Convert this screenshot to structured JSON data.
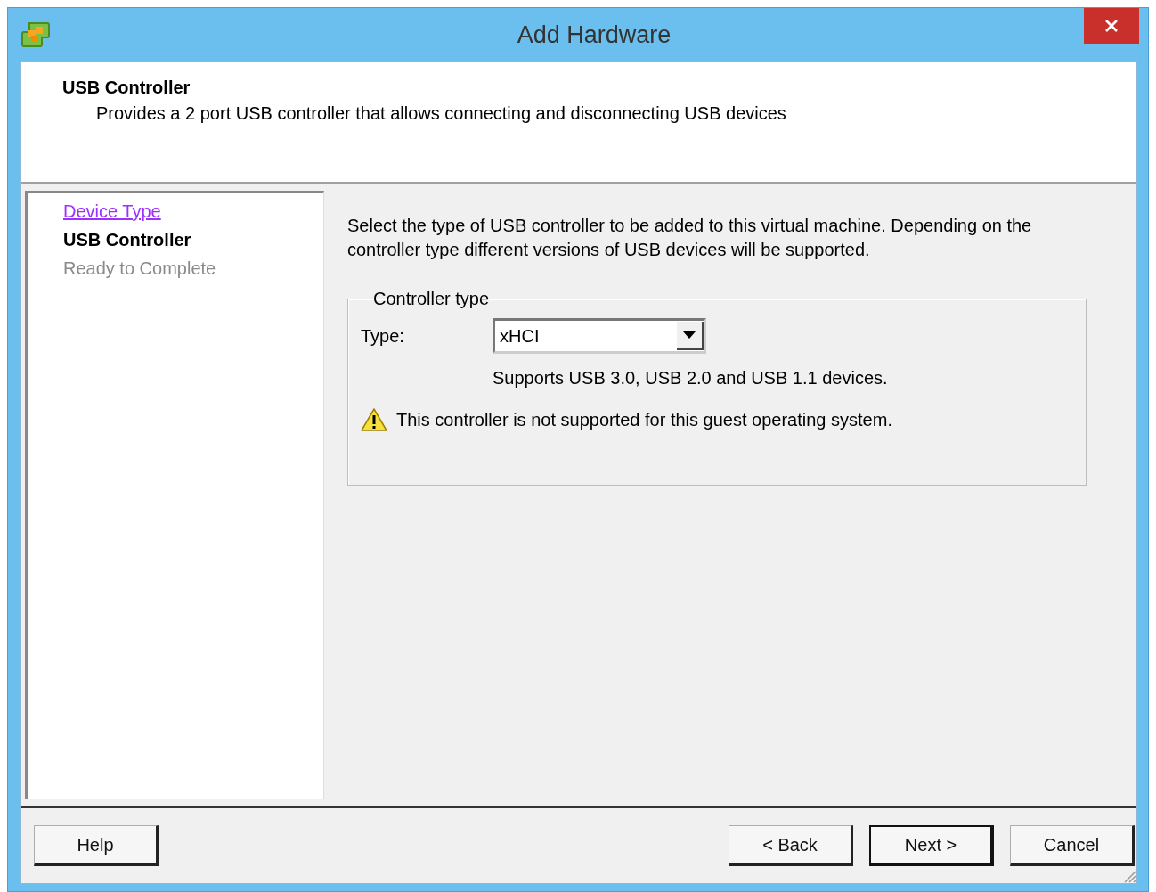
{
  "window": {
    "title": "Add Hardware"
  },
  "header": {
    "title": "USB Controller",
    "description": "Provides a 2 port USB controller that allows connecting and disconnecting USB devices"
  },
  "steps": [
    {
      "label": "Device Type",
      "kind": "link"
    },
    {
      "label": "USB Controller",
      "kind": "current"
    },
    {
      "label": "Ready to Complete",
      "kind": "pending"
    }
  ],
  "content": {
    "instructions": "Select the type of USB controller to be added to this virtual machine. Depending on the controller type different versions of USB devices will be supported.",
    "group": {
      "title": "Controller type",
      "type_label": "Type:",
      "type_value": "xHCI",
      "support_note": "Supports USB 3.0, USB 2.0 and USB 1.1 devices.",
      "warning": "This controller is not supported for this guest operating system."
    }
  },
  "buttons": [
    {
      "label": "Help",
      "default": false
    },
    {
      "label": "< Back",
      "default": false
    },
    {
      "label": "Next >",
      "default": true
    },
    {
      "label": "Cancel",
      "default": false
    }
  ]
}
